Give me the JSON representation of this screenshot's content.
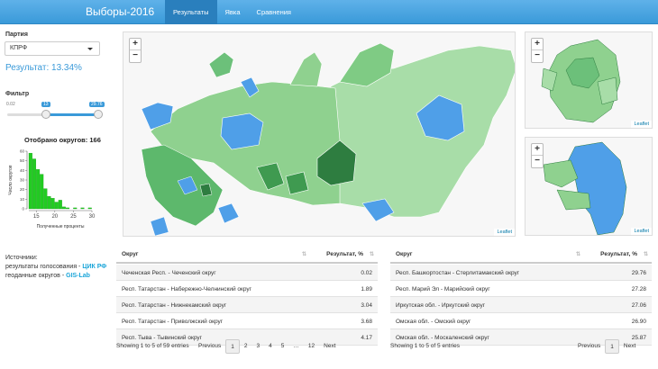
{
  "navbar": {
    "brand": "Выборы-2016",
    "tabs": [
      "Результаты",
      "Явка",
      "Сравнения"
    ]
  },
  "sidebar": {
    "party_label": "Партия",
    "party_value": "КПРФ",
    "result_text": "Результат: 13.34%",
    "filter_label": "Фильтр",
    "slider": {
      "min": "0.02",
      "max": "29.76",
      "from": "13",
      "to": "29.76",
      "from_value": 13,
      "to_value": 29.76,
      "range_min": 0.02,
      "range_max": 29.76
    },
    "histogram": {
      "title": "Отобрано округов: 166",
      "ylabel": "Число округов",
      "xlabel": "Полученные проценты",
      "xticks": [
        "15",
        "20",
        "25",
        "30"
      ],
      "yticks": [
        "0",
        "10",
        "20",
        "30",
        "40",
        "50",
        "60"
      ],
      "bins": [
        13,
        14,
        15,
        16,
        17,
        18,
        19,
        20,
        21,
        22,
        23,
        24,
        25,
        26,
        27,
        28,
        29
      ],
      "values": [
        58,
        52,
        41,
        36,
        21,
        13,
        11,
        7,
        9,
        2,
        1,
        0,
        1,
        0,
        1,
        0,
        1
      ]
    },
    "sources": {
      "title": "Источники:",
      "line1": "результаты голосования - ",
      "link1": "ЦИК РФ",
      "line2": "геоданные округов - ",
      "link2": "GIS-Lab"
    }
  },
  "maps": {
    "zoom_in": "+",
    "zoom_out": "−",
    "attribution": "Leaflet"
  },
  "tables": {
    "col_district": "Округ",
    "col_result": "Результат, %",
    "left": {
      "rows": [
        [
          "Чеченская Респ. - Чеченский округ",
          "0.02"
        ],
        [
          "Респ. Татарстан - Набережно-Челнинский округ",
          "1.89"
        ],
        [
          "Респ. Татарстан - Нижнекамский округ",
          "3.04"
        ],
        [
          "Респ. Татарстан - Приволжский округ",
          "3.68"
        ],
        [
          "Респ. Тыва - Тывинский округ",
          "4.17"
        ]
      ],
      "info": "Showing 1 to 5 of 59 entries",
      "pager": [
        "Previous",
        "1",
        "2",
        "3",
        "4",
        "5",
        "…",
        "12",
        "Next"
      ]
    },
    "right": {
      "rows": [
        [
          "Респ. Башкортостан - Стерлитамакский округ",
          "29.76"
        ],
        [
          "Респ. Марий Эл - Марийский округ",
          "27.28"
        ],
        [
          "Иркутская обл. - Иркутский округ",
          "27.06"
        ],
        [
          "Омская обл. - Омский округ",
          "26.90"
        ],
        [
          "Омская обл. - Москаленский округ",
          "25.87"
        ]
      ],
      "info": "Showing 1 to 5 of 5 entries",
      "pager": [
        "Previous",
        "1",
        "Next"
      ]
    }
  },
  "colors": {
    "accent": "#3a9ad9",
    "map_light_green": "#8fd18f",
    "map_mid_green": "#4caf63",
    "map_dark_green": "#2e7d40",
    "map_blue": "#4f9fe8",
    "histogram_bar": "#22cc22"
  }
}
